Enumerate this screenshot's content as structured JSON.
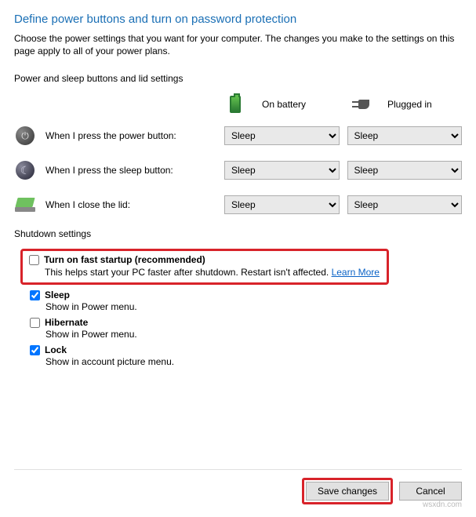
{
  "heading": "Define power buttons and turn on password protection",
  "intro": "Choose the power settings that you want for your computer. The changes you make to the settings on this page apply to all of your power plans.",
  "top_section_label": "Power and sleep buttons and lid settings",
  "columns": {
    "battery": "On battery",
    "plugged": "Plugged in"
  },
  "rows": {
    "power": {
      "label": "When I press the power button:",
      "battery": "Sleep",
      "plugged": "Sleep"
    },
    "sleep": {
      "label": "When I press the sleep button:",
      "battery": "Sleep",
      "plugged": "Sleep"
    },
    "lid": {
      "label": "When I close the lid:",
      "battery": "Sleep",
      "plugged": "Sleep"
    }
  },
  "shutdown_label": "Shutdown settings",
  "options": {
    "fast_startup": {
      "checked": false,
      "title": "Turn on fast startup (recommended)",
      "desc": "This helps start your PC faster after shutdown. Restart isn't affected. ",
      "learn_more": "Learn More"
    },
    "sleep": {
      "checked": true,
      "title": "Sleep",
      "desc": "Show in Power menu."
    },
    "hibernate": {
      "checked": false,
      "title": "Hibernate",
      "desc": "Show in Power menu."
    },
    "lock": {
      "checked": true,
      "title": "Lock",
      "desc": "Show in account picture menu."
    }
  },
  "buttons": {
    "save": "Save changes",
    "cancel": "Cancel"
  },
  "watermark": "wsxdn.com",
  "select_option": "Sleep"
}
